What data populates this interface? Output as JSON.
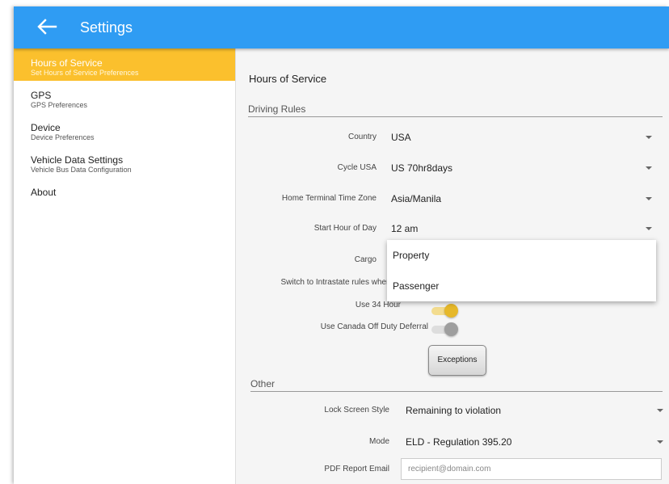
{
  "appbar": {
    "title": "Settings",
    "color": "#2f9cf3"
  },
  "sidebar": {
    "active_color": "#fbc02d",
    "items": [
      {
        "title": "Hours of Service",
        "subtitle": "Set Hours of Service Preferences"
      },
      {
        "title": "GPS",
        "subtitle": "GPS Preferences"
      },
      {
        "title": "Device",
        "subtitle": "Device Preferences"
      },
      {
        "title": "Vehicle Data Settings",
        "subtitle": "Vehicle Bus Data Configuration"
      },
      {
        "title": "About",
        "subtitle": ""
      }
    ]
  },
  "main": {
    "title": "Hours of Service",
    "driving_rules": {
      "heading": "Driving Rules",
      "country": {
        "label": "Country",
        "value": "USA"
      },
      "cycle": {
        "label": "Cycle USA",
        "value": "US 70hr8days"
      },
      "timezone": {
        "label": "Home Terminal Time Zone",
        "value": "Asia/Manila"
      },
      "start_hour": {
        "label": "Start Hour of Day",
        "value": "12 am"
      },
      "cargo": {
        "label": "Cargo"
      },
      "intrastate": {
        "label": "Switch to Intrastate rules when p"
      },
      "use34": {
        "label": "Use 34 Hour",
        "on": true
      },
      "canada_deferral": {
        "label": "Use Canada Off Duty Deferral",
        "on": false
      },
      "exceptions_button": "Exceptions"
    },
    "other": {
      "heading": "Other",
      "lock_screen": {
        "label": "Lock Screen Style",
        "value": "Remaining to violation"
      },
      "mode": {
        "label": "Mode",
        "value": "ELD - Regulation 395.20"
      },
      "pdf_email": {
        "label": "PDF Report Email",
        "placeholder": "recipient@domain.com"
      }
    }
  },
  "cargo_dropdown": {
    "options": [
      "Property",
      "Passenger"
    ]
  }
}
